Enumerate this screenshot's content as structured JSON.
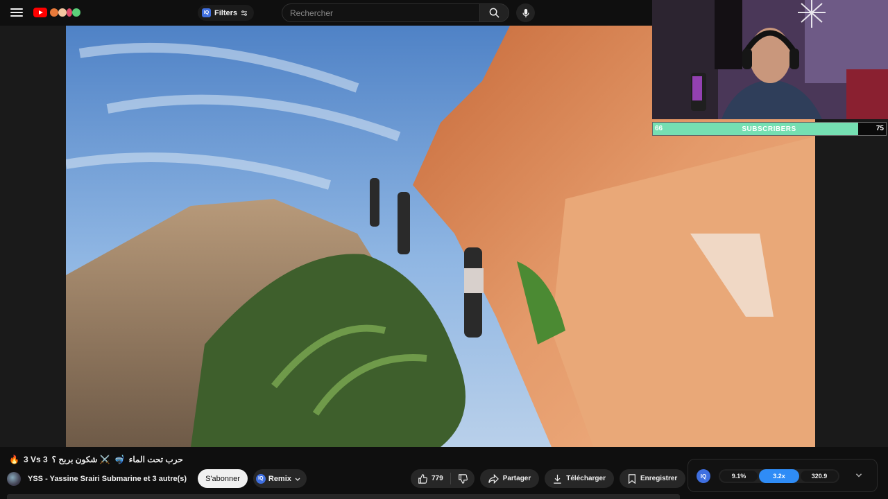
{
  "header": {
    "filters_label": "Filters",
    "filters_badge": "IQ",
    "search_placeholder": "Rechercher"
  },
  "overlay": {
    "subscribers_label": "SUBSCRIBERS",
    "subscribers_current": "66",
    "subscribers_goal": "75",
    "progress_fraction": 0.88,
    "progress_color": "#75dfb2"
  },
  "video": {
    "title_rtl": "حرب تحت الماء",
    "title_mid": "⚔️ شكون بربح ؟",
    "title_ltr": "3 Vs 3",
    "title_emoji": "🔥",
    "title_emoji2": "🤿"
  },
  "channel": {
    "name": "YSS - Yassine Srairi Submarine et 3 autre(s)",
    "subscribe_label": "S'abonner",
    "remix_label": "Remix",
    "remix_badge": "IQ"
  },
  "actions": {
    "like_count": "779",
    "share_label": "Partager",
    "download_label": "Télécharger",
    "save_label": "Enregistrer"
  },
  "iq_panel": {
    "logo": "IQ",
    "values": [
      "9.1%",
      "3.2x",
      "320.9"
    ],
    "active_index": 1,
    "accent": "#2f8cf6"
  },
  "icons": [
    "menu-icon",
    "youtube-logo-icon",
    "filters-icon",
    "search-icon",
    "microphone-icon",
    "like-icon",
    "dislike-icon",
    "share-icon",
    "download-icon",
    "save-icon",
    "more-icon",
    "chevron-down-icon"
  ]
}
